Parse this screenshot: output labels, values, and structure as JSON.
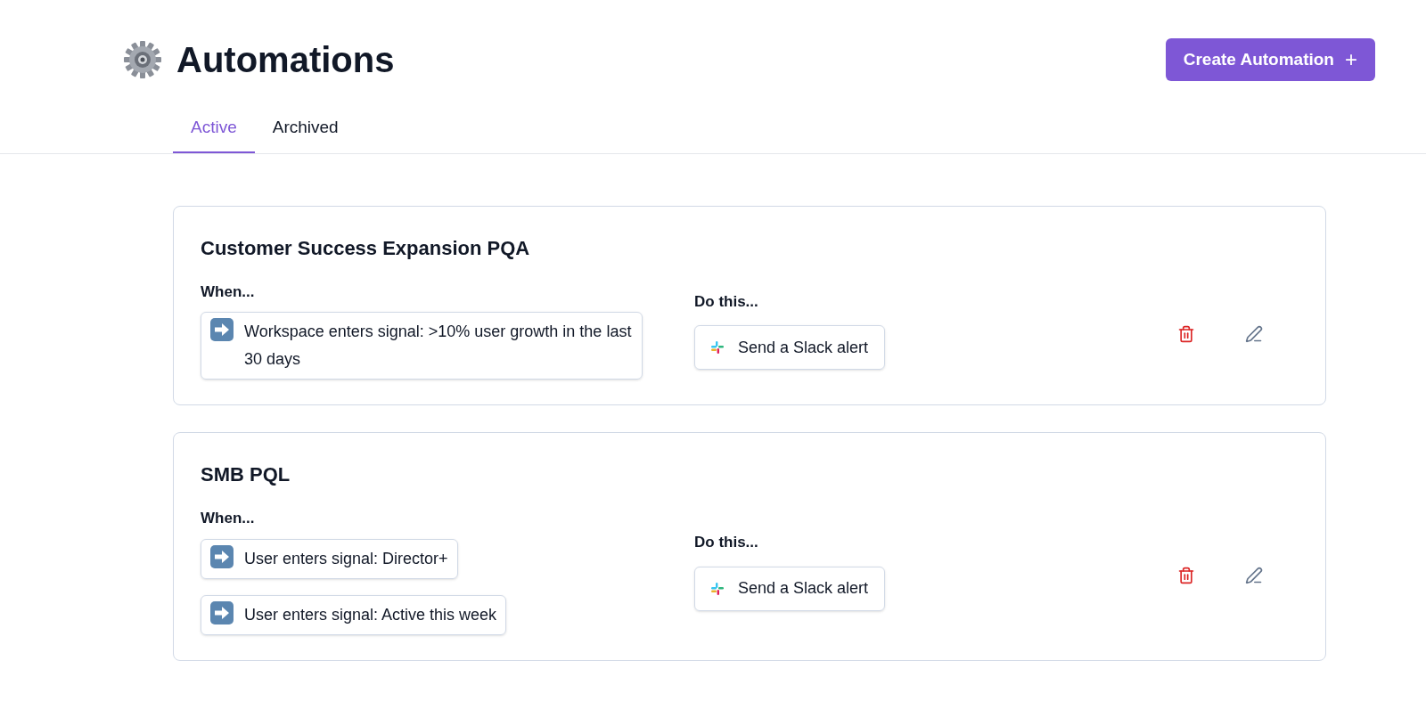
{
  "header": {
    "title": "Automations",
    "create_button": "Create Automation",
    "create_icon": "+"
  },
  "tabs": [
    {
      "label": "Active",
      "selected": true
    },
    {
      "label": "Archived",
      "selected": false
    }
  ],
  "automations": [
    {
      "name": "Customer Success Expansion PQA",
      "when_label": "When...",
      "conditions": [
        "Workspace enters signal: >10% user growth in the last 30 days"
      ],
      "do_label": "Do this...",
      "action": "Send a Slack alert"
    },
    {
      "name": "SMB PQL",
      "when_label": "When...",
      "conditions": [
        "User enters signal: Director+",
        "User enters signal: Active this week"
      ],
      "do_label": "Do this...",
      "action": "Send a Slack alert"
    }
  ]
}
